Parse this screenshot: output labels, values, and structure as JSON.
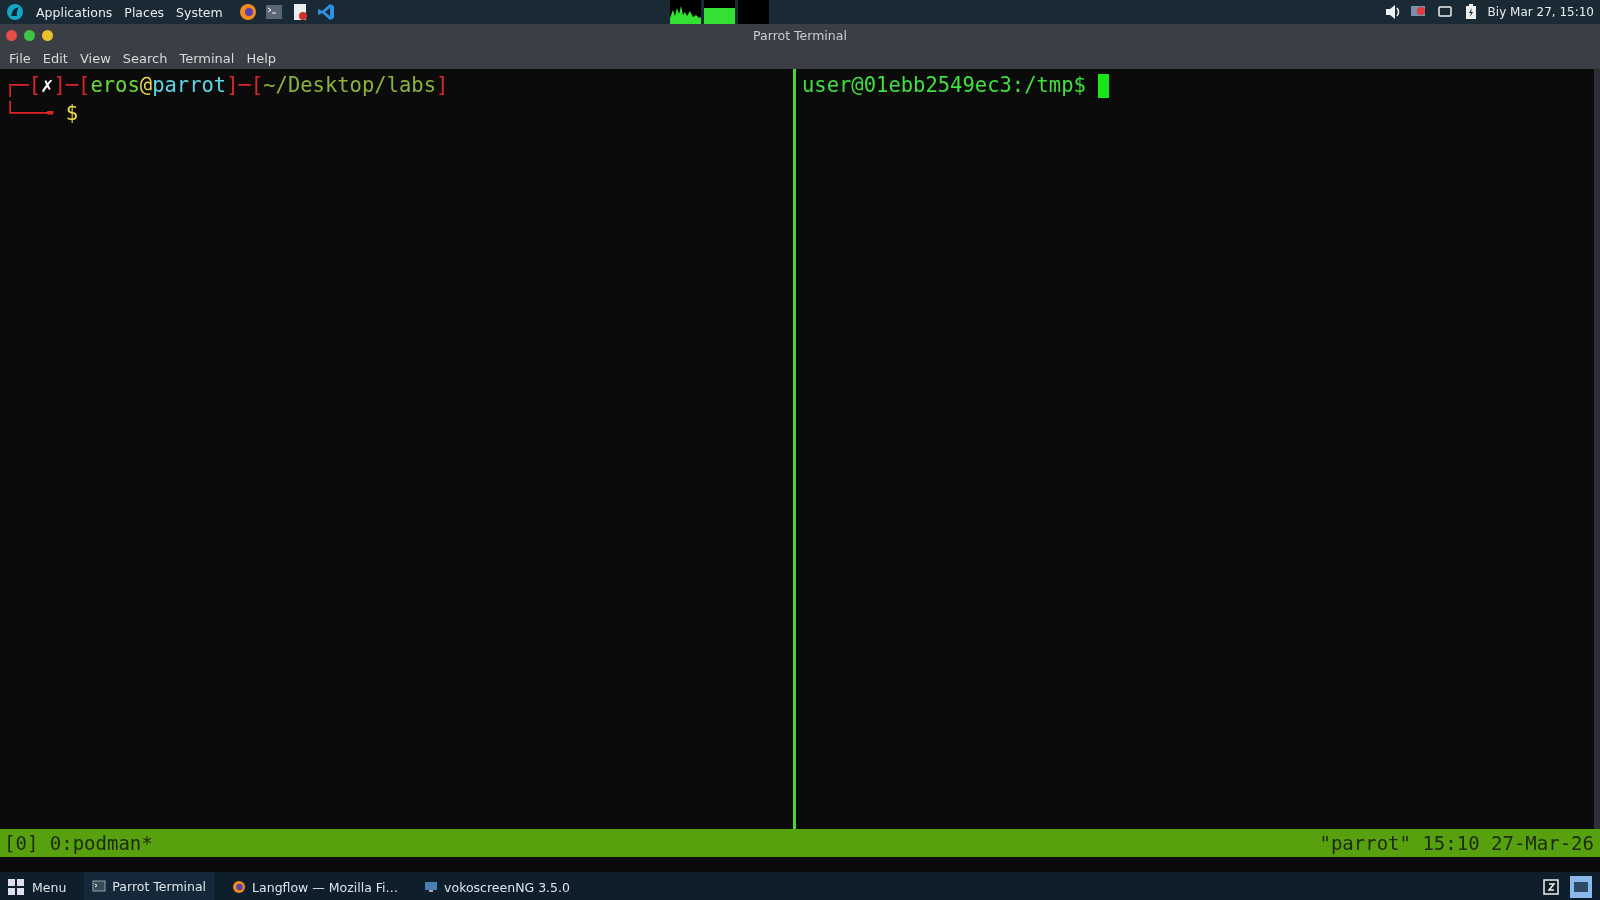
{
  "top_panel": {
    "menus": [
      {
        "label": "Applications"
      },
      {
        "label": "Places"
      },
      {
        "label": "System"
      }
    ],
    "clock": "Biy Mar 27, 15:10"
  },
  "window": {
    "title": "Parrot Terminal"
  },
  "menubar": [
    "File",
    "Edit",
    "View",
    "Search",
    "Terminal",
    "Help"
  ],
  "left_pane": {
    "prompt": [
      {
        "text": "┌─[",
        "kind": "frame"
      },
      {
        "text": "✗",
        "kind": "status"
      },
      {
        "text": "]─[",
        "kind": "frame"
      },
      {
        "text": "eros",
        "kind": "user"
      },
      {
        "text": "@",
        "kind": "at"
      },
      {
        "text": "parrot",
        "kind": "host"
      },
      {
        "text": "]─[",
        "kind": "frame"
      },
      {
        "text": "~/Desktop/labs",
        "kind": "path"
      },
      {
        "text": "]",
        "kind": "frame"
      }
    ],
    "input_line": [
      {
        "text": "└──╼ ",
        "kind": "frame"
      },
      {
        "text": "$",
        "kind": "dollar"
      }
    ]
  },
  "right_pane": {
    "prompt": "user@01ebb2549ec3:/tmp$ "
  },
  "status_bar": {
    "left": "[0] 0:podman*",
    "right": "\"parrot\" 15:10 27-Mar-26"
  },
  "taskbar": {
    "menu_label": "Menu",
    "tasks": [
      {
        "label": "Parrot Terminal",
        "kind": "terminal",
        "selected": true
      },
      {
        "label": "Langflow — Mozilla Fi…",
        "kind": "browser",
        "selected": false
      },
      {
        "label": "vokoscreenNG 3.5.0",
        "kind": "screen",
        "selected": false
      }
    ]
  }
}
